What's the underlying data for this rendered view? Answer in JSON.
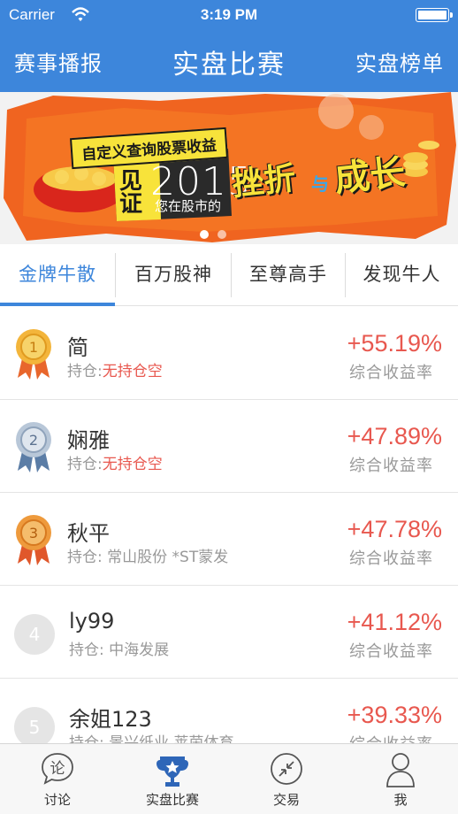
{
  "status": {
    "carrier": "Carrier",
    "time": "3:19 PM"
  },
  "nav": {
    "left": "赛事播报",
    "title": "实盘比赛",
    "right": "实盘榜单"
  },
  "banner": {
    "tag": "自定义查询股票收益",
    "jian": "见",
    "zheng": "证",
    "year": "2015",
    "sub": "您在股市的",
    "big1": "挫折",
    "yu": "与",
    "big2": "成长",
    "colors": {
      "orange": "#f06420",
      "yellow": "#f8e33a"
    }
  },
  "tabs": [
    {
      "label": "金牌牛散",
      "active": true
    },
    {
      "label": "百万股神",
      "active": false
    },
    {
      "label": "至尊高手",
      "active": false
    },
    {
      "label": "发现牛人",
      "active": false
    }
  ],
  "rows": [
    {
      "rank": "1",
      "medal": "gold",
      "name": "简",
      "hold_label": "持仓:",
      "hold_value": "无持仓空",
      "highlight": true,
      "pct": "+55.19%",
      "pct_label": "综合收益率"
    },
    {
      "rank": "2",
      "medal": "silver",
      "name": "娴雅",
      "hold_label": "持仓:",
      "hold_value": "无持仓空",
      "highlight": true,
      "pct": "+47.89%",
      "pct_label": "综合收益率"
    },
    {
      "rank": "3",
      "medal": "bronze",
      "name": "秋平",
      "hold_label": "持仓:",
      "hold_value": " 常山股份 *ST蒙发",
      "highlight": false,
      "pct": "+47.78%",
      "pct_label": "综合收益率"
    },
    {
      "rank": "4",
      "medal": "none",
      "name": "ly99",
      "hold_label": "持仓:",
      "hold_value": " 中海发展",
      "highlight": false,
      "pct": "+41.12%",
      "pct_label": "综合收益率"
    },
    {
      "rank": "5",
      "medal": "none",
      "name": "余姐123",
      "hold_label": "持仓:",
      "hold_value": " 景兴纸业 莱茵体育",
      "highlight": false,
      "pct": "+39.33%",
      "pct_label": "综合收益率"
    }
  ],
  "tabbar": [
    {
      "label": "讨论",
      "icon": "discussion-icon",
      "glyph": "论"
    },
    {
      "label": "实盘比赛",
      "icon": "trophy-icon"
    },
    {
      "label": "交易",
      "icon": "trade-icon"
    },
    {
      "label": "我",
      "icon": "person-icon"
    }
  ],
  "colors": {
    "accent": "#3d86db",
    "gain": "#e8584f"
  }
}
